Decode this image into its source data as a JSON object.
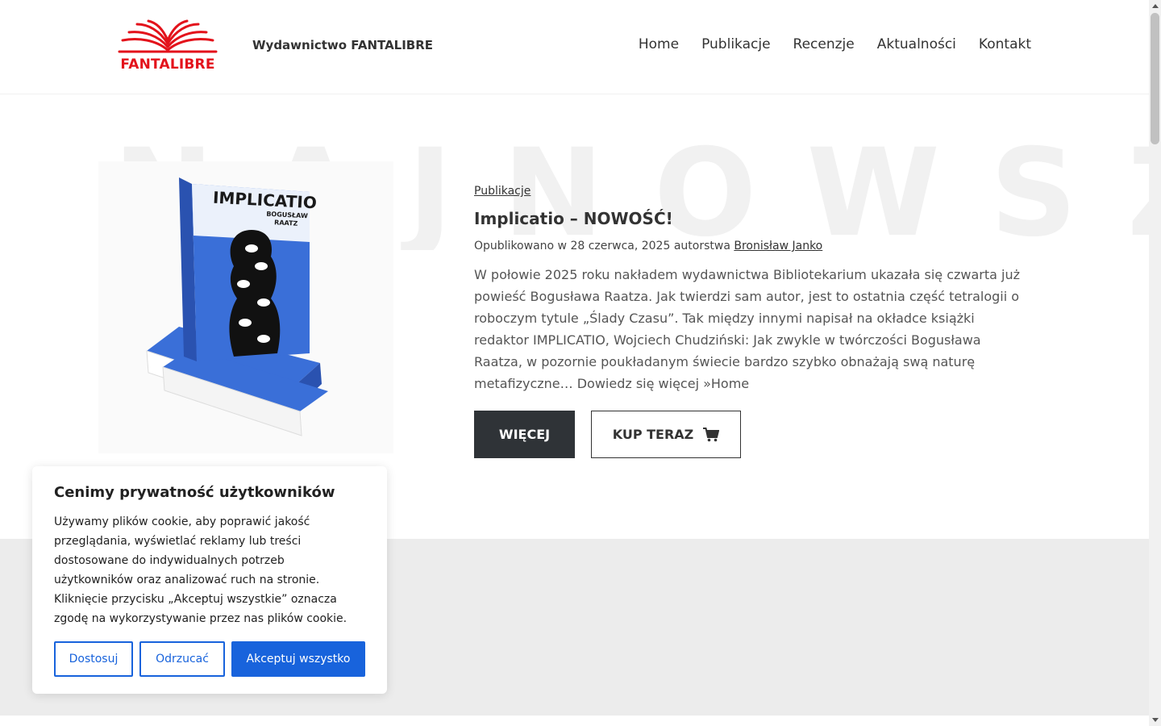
{
  "header": {
    "logo_text": "FANTALIBRE",
    "site_title": "Wydawnictwo FANTALIBRE",
    "nav": [
      "Home",
      "Publikacje",
      "Recenzje",
      "Aktualności",
      "Kontakt"
    ]
  },
  "hero": {
    "watermark": "NAJNOWSZ",
    "book": {
      "title": "IMPLICATIO",
      "author": "BOGUSŁAW RAATZ",
      "cover_color": "#3a6fd8"
    },
    "category": "Publikacje",
    "post_title": "Implicatio – NOWOŚĆ!",
    "meta_prefix": "Opublikowano w 28 czerwca, 2025 autorstwa",
    "meta_author": "Bronisław Janko",
    "excerpt": "W połowie 2025 roku nakładem wydawnictwa Bibliotekarium ukazała się czwarta już powieść Bogusława Raatza. Jak twierdzi sam autor, jest to ostatnia część tetralogii o roboczym tytule „Ślady Czasu”. Tak między innymi napisał na okładce książki redaktor IMPLICATIO, Wojciech Chudziński: Jak zwykle w twórczości Bogusława Raatza, w pozornie poukładanym świecie bardzo szybko obnażają swą naturę metafizyczne… Dowiedz się więcej »Home",
    "btn_more": "WIĘCEJ",
    "btn_buy": "KUP TERAZ"
  },
  "cookie": {
    "title": "Cenimy prywatność użytkowników",
    "text": "Używamy plików cookie, aby poprawić jakość przeglądania, wyświetlać reklamy lub treści dostosowane do indywidualnych potrzeb użytkowników oraz analizować ruch na stronie. Kliknięcie przycisku „Akceptuj wszystkie” oznacza zgodę na wykorzystywanie przez nas plików cookie.",
    "btn_customize": "Dostosuj",
    "btn_reject": "Odrzucać",
    "btn_accept": "Akceptuj wszystko"
  },
  "colors": {
    "brand_red": "#e3121b",
    "accent_blue": "#1863dc",
    "dark_button": "#2f3337"
  }
}
